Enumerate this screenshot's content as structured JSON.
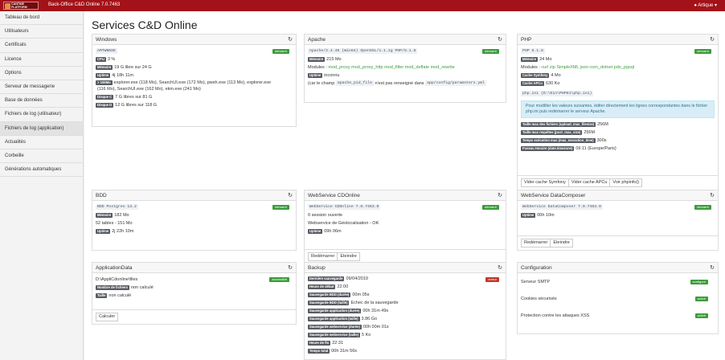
{
  "app": {
    "logo_text": "CANTINE PLATFORM",
    "title": "Back-Office C&D Online 7.0.7463",
    "user": "Artique"
  },
  "sidebar": [
    "Tableau de bord",
    "Utilisateurs",
    "Certificats",
    "Licence",
    "Options",
    "Serveur de messagerie",
    "Base de données",
    "Fichiers de log (utilisateur)",
    "Fichiers de log (application)",
    "Actualités",
    "Corbeille",
    "Générations automatiques"
  ],
  "page_title": "Services C&D Online",
  "windows": {
    "title": "Windows",
    "code": "AMTWNEDE",
    "badge": "démarré",
    "rows": [
      [
        "CPU",
        "3 %"
      ],
      [
        "Mémoire",
        "19 G libre sur 24 G"
      ],
      [
        "Uptime",
        "4j 18h 11m"
      ],
      [
        "> 100Mo",
        "explorer.exe (118 Mo), SearchUI.exe (172 Mo), pwsh.exe (113 Mo), explorer.exe"
      ],
      [
        "",
        "(116 Mo), SearchUI.exe (162 Mo), ekm.exe (241 Mo)"
      ],
      [
        "Disque C",
        "7 G libres sur 81 G"
      ],
      [
        "Disque D",
        "12 G libres sur 118 G"
      ]
    ]
  },
  "apache": {
    "title": "Apache",
    "code": "Apache/2.4.46 (Win64) OpenSSL/1.1.1g PHP/8.1.8",
    "badge": "démarré",
    "mem_label": "Mémoire",
    "mem": "215 Mo",
    "modules_label": "Modules :",
    "modules": "mod_proxy mod_proxy_http mod_filter mod_deflate mod_rewrite",
    "uptime_label": "Uptime",
    "uptime": "inconnu",
    "note_a": "(car le champ",
    "note_code": "apache_pid_file",
    "note_b": "n'est pas renseigné dans",
    "note_path": "app/config/parameters.yml"
  },
  "php": {
    "title": "PHP",
    "code": "PHP 8.1.8",
    "badge": "démarré",
    "mem_label": "Mémoire",
    "mem": "24 Mo",
    "modules_label": "Modules :",
    "modules": "curl zip SimpleXML json com_dotnet pdo_pgsql",
    "cache_label": "Cache Symfony",
    "cache": "4 Mo",
    "apcu_label": "Cache APCu",
    "apcu": "630 Ko",
    "ini": "php.ini (D:\\Ein\\PHP81\\php.ini)",
    "info": "Pour modifier les valeurs suivantes, éditer directement les lignes correspondantes dans le fichier php.ini puis redémarrer le serveur Apache.",
    "settings": [
      [
        "Taille max des fichiers (upload_max_filesize)",
        "256M"
      ],
      [
        "Taille max requêtes (post_max_size)",
        "256M"
      ],
      [
        "Temps exécution max (max_execution_time)",
        "300s"
      ],
      [
        "Fuseau Horaire (date.timezone)",
        "09:11 (Europe/Paris)"
      ]
    ],
    "buttons": [
      "Vider cache Symfony",
      "Vider cache APCu",
      "Voir phpinfo()"
    ]
  },
  "bdd": {
    "title": "BDD",
    "code": "BDD Postgres 13.2",
    "badge": "démarré",
    "mem_label": "Mémoire",
    "mem": "182 Mo",
    "tables": "52 tables - 151 Mo",
    "uptime_label": "Uptime",
    "uptime": "2j 22h 10m"
  },
  "cdonline": {
    "title": "WebService CDOnline",
    "code": "WebService CDOnline 7.0.7463.0",
    "badge": "démarré",
    "sessions": "0 session ouverte",
    "geo": "Webservice de Géolocalisation - OK",
    "uptime_label": "Uptime",
    "uptime": "09h 06m",
    "buttons": [
      "Redémarrer",
      "Eteindre"
    ]
  },
  "datacomposer": {
    "title": "WebService DataComposer",
    "code": "WebService DataComposer 7.0.7463.0",
    "badge": "démarré",
    "uptime_label": "Uptime",
    "uptime": "00h 10m",
    "buttons": [
      "Redémarrer",
      "Eteindre"
    ]
  },
  "appdata": {
    "title": "ApplicationData",
    "path": "D:\\AppliCdonline\\files",
    "badge": "accessible",
    "rows": [
      [
        "Nombre de fichiers",
        "non calculé"
      ],
      [
        "Taille",
        "non calculé"
      ]
    ],
    "button": "Calculer"
  },
  "backup": {
    "title": "Backup",
    "badge": "erreur",
    "rows": [
      [
        "Dernière sauvegarde",
        "09/04/2019"
      ],
      [
        "Heure de début",
        "22:00"
      ],
      [
        "Sauvegarde BDD (durée)",
        "00m 05s"
      ],
      [
        "Sauvegarde BDD (taille)",
        "Echec de la sauvegarde"
      ],
      [
        "Sauvegarde application (durée)",
        "00h 31m 49s"
      ],
      [
        "Sauvegarde application (taille)",
        "3.86 Go"
      ],
      [
        "Sauvegarde webservice (durée)",
        "00h 00m 01s"
      ],
      [
        "Sauvegarde webservice (taille)",
        "5 Ko"
      ],
      [
        "Heure de fin",
        "22:31"
      ],
      [
        "Temps total",
        "00h 31m 56s"
      ]
    ]
  },
  "config": {
    "title": "Configuration",
    "items": [
      [
        "Serveur SMTP",
        "configuré"
      ],
      [
        "Cookies sécurisés",
        "activé"
      ],
      [
        "Protection contre les attaques XSS",
        "activé"
      ]
    ]
  },
  "colors": {
    "topbar": "#a31218",
    "success": "#3c9c3c",
    "danger": "#c0392b",
    "tag": "#575b62"
  }
}
